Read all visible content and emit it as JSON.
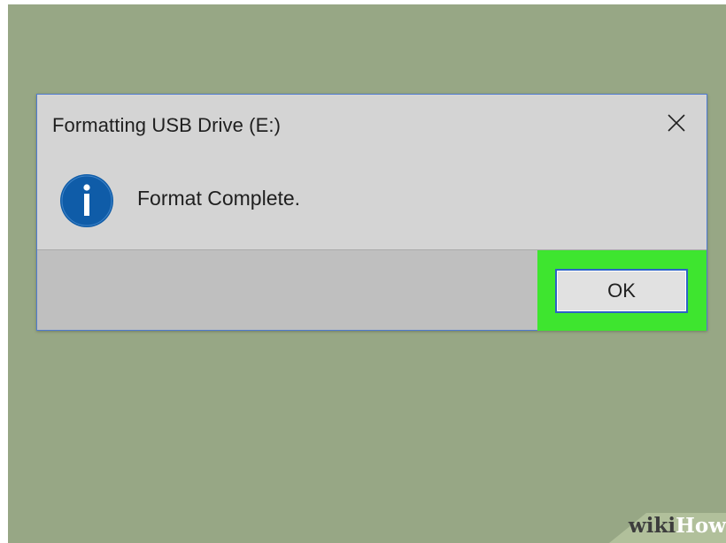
{
  "dialog": {
    "title": "Formatting USB Drive (E:)",
    "message": "Format Complete.",
    "ok_label": "OK"
  },
  "icons": {
    "info": "info-icon",
    "close": "close-icon"
  },
  "watermark": {
    "part1": "wiki",
    "part2": "How"
  },
  "colors": {
    "desktop": "#97a785",
    "dialog": "#d4d4d4",
    "footer": "#bfbfbf",
    "highlight": "#3ee52f",
    "info_icon": "#0f5ca8",
    "button_border": "#2c62c6"
  }
}
